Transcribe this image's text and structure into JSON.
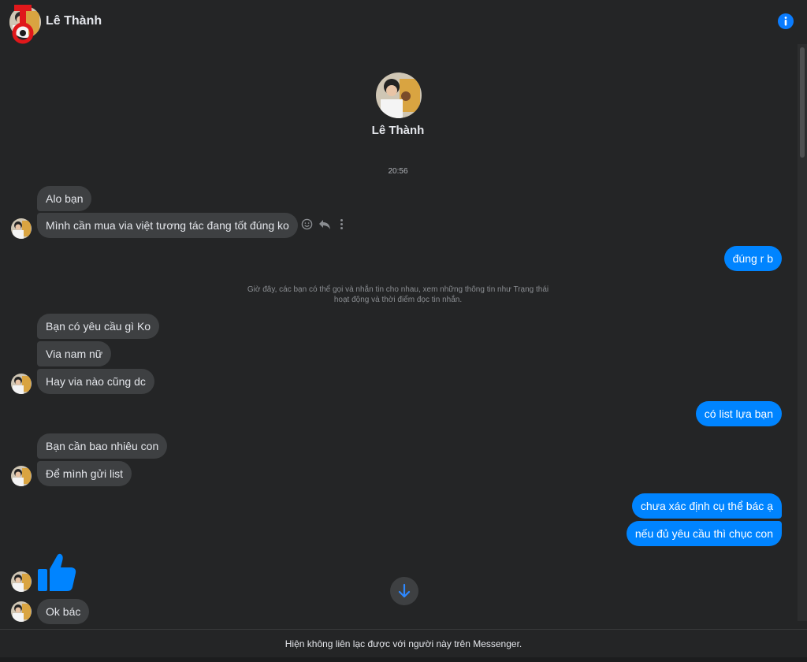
{
  "header": {
    "title": "Lê Thành"
  },
  "profile": {
    "name": "Lê Thành"
  },
  "conversation": {
    "timestamp": "20:56",
    "notice": "Giờ đây, các bạn có thể gọi và nhắn tin cho nhau, xem những thông tin như Trạng thái hoạt động và thời điểm đọc tin nhắn.",
    "messages": [
      "Alo bạn",
      "Mình cần mua via việt tương tác đang tốt đúng ko",
      "đúng r b",
      "Bạn có yêu cầu gì Ko",
      "Via nam nữ",
      "Hay via nào cũng dc",
      "có list lựa bạn",
      "Bạn cần bao nhiêu con",
      "Để mình gửi list",
      "chưa xác định cụ thể bác ạ",
      "nếu đủ yêu cầu thì chục con",
      "Ok bác"
    ]
  },
  "footer": {
    "status": "Hiện không liên lạc được với người này trên Messenger."
  },
  "colors": {
    "accent": "#0084ff",
    "incoming_bubble": "#3e4042",
    "background": "#242526"
  },
  "icons": [
    "info-icon",
    "react-icon",
    "reply-icon",
    "more-icon",
    "like-icon",
    "arrow-down-icon"
  ]
}
